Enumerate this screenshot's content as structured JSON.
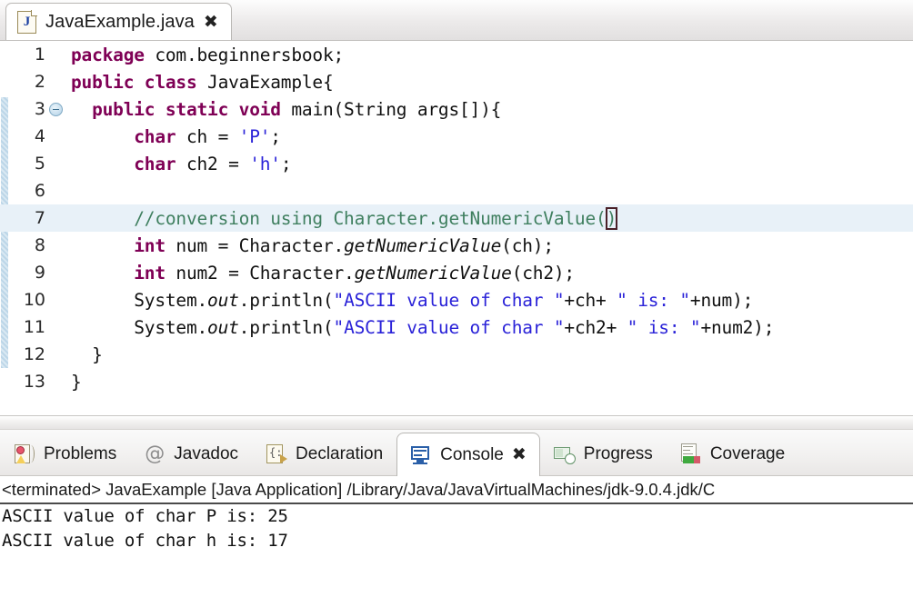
{
  "editor": {
    "tab": {
      "title": "JavaExample.java",
      "file_icon_letter": "J",
      "close_label": "✖"
    },
    "lines": [
      {
        "no": "1",
        "foldable": false,
        "current": false,
        "segments": [
          {
            "t": "package ",
            "c": "kw"
          },
          {
            "t": "com.beginnersbook;",
            "c": ""
          }
        ]
      },
      {
        "no": "2",
        "foldable": false,
        "current": false,
        "segments": [
          {
            "t": "public class ",
            "c": "kw"
          },
          {
            "t": "JavaExample{",
            "c": ""
          }
        ]
      },
      {
        "no": "3",
        "foldable": true,
        "current": false,
        "segments": [
          {
            "t": "  ",
            "c": ""
          },
          {
            "t": "public static void ",
            "c": "kw"
          },
          {
            "t": "main(String args[]){",
            "c": ""
          }
        ]
      },
      {
        "no": "4",
        "foldable": false,
        "current": false,
        "segments": [
          {
            "t": "      ",
            "c": ""
          },
          {
            "t": "char ",
            "c": "kw"
          },
          {
            "t": "ch = ",
            "c": ""
          },
          {
            "t": "'P'",
            "c": "str"
          },
          {
            "t": ";",
            "c": ""
          }
        ]
      },
      {
        "no": "5",
        "foldable": false,
        "current": false,
        "segments": [
          {
            "t": "      ",
            "c": ""
          },
          {
            "t": "char ",
            "c": "kw"
          },
          {
            "t": "ch2 = ",
            "c": ""
          },
          {
            "t": "'h'",
            "c": "str"
          },
          {
            "t": ";",
            "c": ""
          }
        ]
      },
      {
        "no": "6",
        "foldable": false,
        "current": false,
        "segments": []
      },
      {
        "no": "7",
        "foldable": false,
        "current": true,
        "segments": [
          {
            "t": "      ",
            "c": ""
          },
          {
            "t": "//conversion using Character.getNumericValue(",
            "c": "cmt"
          },
          {
            "t": ")",
            "c": "cmt box"
          }
        ]
      },
      {
        "no": "8",
        "foldable": false,
        "current": false,
        "segments": [
          {
            "t": "      ",
            "c": ""
          },
          {
            "t": "int ",
            "c": "kw"
          },
          {
            "t": "num = Character.",
            "c": ""
          },
          {
            "t": "getNumericValue",
            "c": "itl"
          },
          {
            "t": "(ch);",
            "c": ""
          }
        ]
      },
      {
        "no": "9",
        "foldable": false,
        "current": false,
        "segments": [
          {
            "t": "      ",
            "c": ""
          },
          {
            "t": "int ",
            "c": "kw"
          },
          {
            "t": "num2 = Character.",
            "c": ""
          },
          {
            "t": "getNumericValue",
            "c": "itl"
          },
          {
            "t": "(ch2);",
            "c": ""
          }
        ]
      },
      {
        "no": "10",
        "foldable": false,
        "current": false,
        "segments": [
          {
            "t": "      ",
            "c": ""
          },
          {
            "t": "System.",
            "c": ""
          },
          {
            "t": "out",
            "c": "itl"
          },
          {
            "t": ".println(",
            "c": ""
          },
          {
            "t": "\"ASCII value of char \"",
            "c": "str"
          },
          {
            "t": "+ch+ ",
            "c": ""
          },
          {
            "t": "\" is: \"",
            "c": "str"
          },
          {
            "t": "+num);",
            "c": ""
          }
        ]
      },
      {
        "no": "11",
        "foldable": false,
        "current": false,
        "segments": [
          {
            "t": "      ",
            "c": ""
          },
          {
            "t": "System.",
            "c": ""
          },
          {
            "t": "out",
            "c": "itl"
          },
          {
            "t": ".println(",
            "c": ""
          },
          {
            "t": "\"ASCII value of char \"",
            "c": "str"
          },
          {
            "t": "+ch2+ ",
            "c": ""
          },
          {
            "t": "\" is: \"",
            "c": "str"
          },
          {
            "t": "+num2);",
            "c": ""
          }
        ]
      },
      {
        "no": "12",
        "foldable": false,
        "current": false,
        "segments": [
          {
            "t": "  }",
            "c": ""
          }
        ]
      },
      {
        "no": "13",
        "foldable": false,
        "current": false,
        "segments": [
          {
            "t": "}",
            "c": ""
          }
        ]
      }
    ]
  },
  "view_tabs": [
    {
      "label": "Problems",
      "icon": "problems-icon",
      "active": false,
      "closable": false
    },
    {
      "label": "Javadoc",
      "icon": "javadoc-at-icon",
      "active": false,
      "closable": false
    },
    {
      "label": "Declaration",
      "icon": "declaration-icon",
      "active": false,
      "closable": false
    },
    {
      "label": "Console",
      "icon": "console-monitor-icon",
      "active": true,
      "closable": true
    },
    {
      "label": "Progress",
      "icon": "progress-icon",
      "active": false,
      "closable": false
    },
    {
      "label": "Coverage",
      "icon": "coverage-icon",
      "active": false,
      "closable": false
    }
  ],
  "console": {
    "close_label": "✖",
    "header": "<terminated> JavaExample [Java Application] /Library/Java/JavaVirtualMachines/jdk-9.0.4.jdk/C",
    "output": [
      "ASCII value of char P is: 25",
      "ASCII value of char h is: 17"
    ]
  },
  "colors": {
    "keyword": "#7f0055",
    "string": "#2a22d8",
    "comment": "#3f7f5f",
    "current_line": "#e8f1f8",
    "change_bar": "#bcd6e8"
  }
}
